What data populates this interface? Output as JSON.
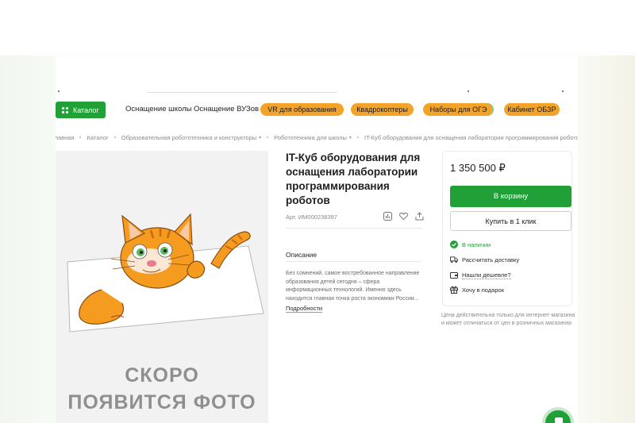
{
  "nav": {
    "catalog_label": "Каталог",
    "links": [
      "Оснащение школы",
      "Оснащение ВУЗов"
    ],
    "pills": [
      "VR для образования",
      "Квадрокоптеры",
      "Наборы для ОГЭ",
      "Кабинет ОБЗР"
    ]
  },
  "breadcrumbs": [
    "главная",
    "Каталог",
    "Образовательная робототехника и конструкторы",
    "Робототехника для школы",
    "IT-Куб оборудования для оснащения лаборатории программирования роботов"
  ],
  "photo": {
    "soon_line1": "СКОРО",
    "soon_line2": "ПОЯВИТСЯ ФОТО"
  },
  "product": {
    "title": "IT-Куб оборудования для оснащения лаборатории программирования роботов",
    "article": "Арт. ИМ000238397",
    "description_tab": "Описание",
    "description": "Без сомнений, самое востребованное направление образования детей сегодня – сфера информационных технологий. Именно здесь находится главная точка роста экономики России...",
    "more_link": "Подробности"
  },
  "buy": {
    "price": "1 350 500 ₽",
    "cart_button": "В корзину",
    "one_click_button": "Купить в 1 клик",
    "in_stock": "В наличии",
    "delivery": "Рассчитать доставку",
    "cheaper": "Нашли дешевле?",
    "gift": "Хочу в подарок",
    "note": "Цена действительна только для интернет-магазина и может отличаться от цен в розничных магазинах"
  },
  "colors": {
    "accent_green": "#21a038",
    "pill_orange": "#f4a329"
  },
  "icons": [
    "grid-icon",
    "compare-icon",
    "heart-icon",
    "share-icon",
    "check-circle-icon",
    "truck-icon",
    "wallet-icon",
    "gift-icon",
    "chat-icon"
  ]
}
